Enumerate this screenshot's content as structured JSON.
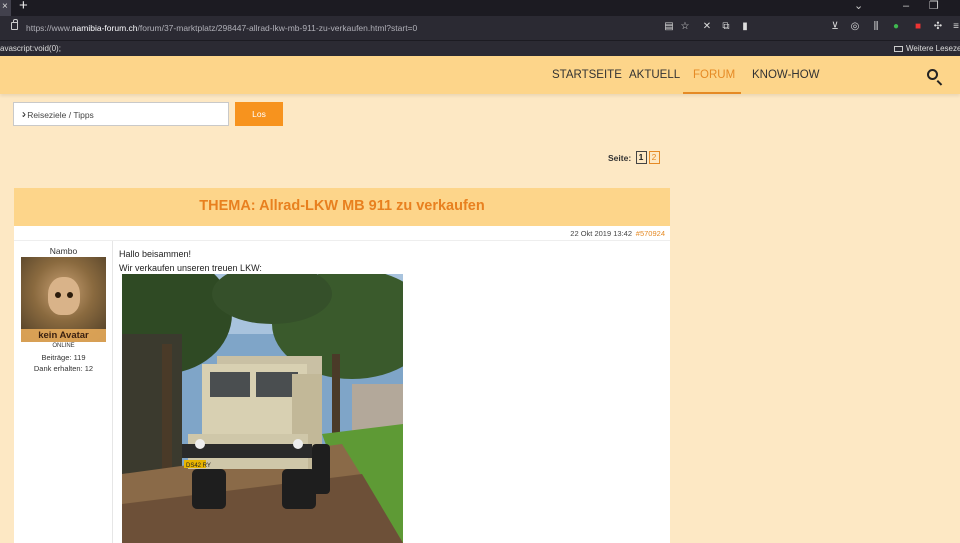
{
  "browser": {
    "tab_close_glyph": "×",
    "new_tab_glyph": "+",
    "url_host": "namibia-forum.ch",
    "url_prefix": "https://www.",
    "url_path": "/forum/37-marktplatz/298447-allrad-lkw-mb-911-zu-verkaufen.html?start=0",
    "bookmark_js": "avascript:void(0);",
    "bookmark_more": "Weitere Lesezeich"
  },
  "nav": {
    "items": [
      {
        "label": "STARTSEITE"
      },
      {
        "label": "AKTUELL"
      },
      {
        "label": "FORUM"
      },
      {
        "label": "KNOW-HOW"
      }
    ]
  },
  "jump": {
    "selected": "- Reiseziele / Tipps",
    "button": "Los"
  },
  "pagination": {
    "label": "Seite:",
    "pages": [
      "1",
      "2"
    ]
  },
  "thread": {
    "title": "THEMA: Allrad-LKW MB 911 zu verkaufen"
  },
  "post": {
    "date": "22 Okt 2019 13:42",
    "id": "#570924",
    "author": {
      "name": "Nambo",
      "avatar_label": "kein Avatar",
      "status": "ONLINE",
      "posts": "Beiträge: 119",
      "thanks": "Dank erhalten: 12"
    },
    "lines": [
      "Hallo beisammen!",
      "Wir verkaufen unseren treuen LKW:"
    ],
    "license_plate": "DS42 RY"
  },
  "colors": {
    "accent": "#e58a25",
    "header_bg": "#fdd58a",
    "page_bg": "#fde8c4",
    "button": "#f7931e"
  }
}
